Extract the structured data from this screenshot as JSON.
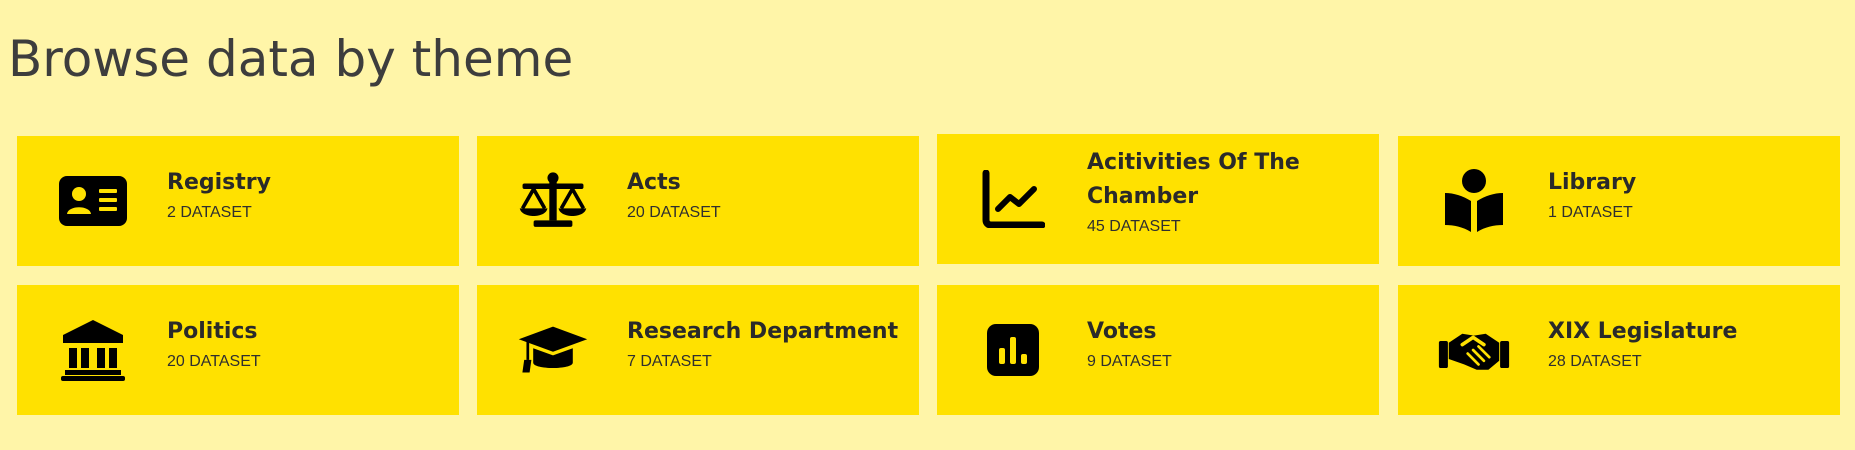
{
  "page": {
    "title": "Browse data by theme"
  },
  "themes": [
    {
      "title": "Registry",
      "count": "2",
      "unit": "DATASET",
      "icon": "id-card-icon"
    },
    {
      "title": "Acts",
      "count": "20",
      "unit": "DATASET",
      "icon": "scale-icon"
    },
    {
      "title": "Acitivities Of The Chamber",
      "count": "45",
      "unit": "DATASET",
      "icon": "line-chart-icon"
    },
    {
      "title": "Library",
      "count": "1",
      "unit": "DATASET",
      "icon": "reader-icon"
    },
    {
      "title": "Politics",
      "count": "20",
      "unit": "DATASET",
      "icon": "landmark-icon"
    },
    {
      "title": "Research Department",
      "count": "7",
      "unit": "DATASET",
      "icon": "graduation-cap-icon"
    },
    {
      "title": "Votes",
      "count": "9",
      "unit": "DATASET",
      "icon": "bar-chart-icon"
    },
    {
      "title": "XIX Legislature",
      "count": "28",
      "unit": "DATASET",
      "icon": "handshake-icon"
    }
  ],
  "colors": {
    "page_background": "#fff5a8",
    "card_background": "#ffe100",
    "title_text": "#3d3d3d",
    "card_text": "#2a2a2a",
    "icon": "#000000"
  }
}
